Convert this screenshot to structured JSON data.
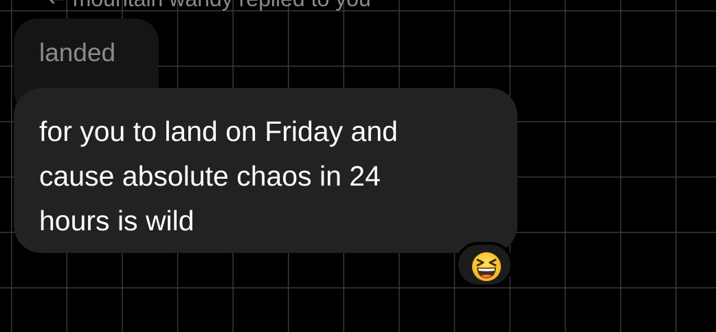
{
  "reply_header": "↩ mountain wandy replied to you",
  "quoted_message": {
    "text": "landed"
  },
  "message": {
    "text": "for you to land on Friday and\ncause absolute chaos in 24\nhours is wild"
  },
  "reaction": {
    "icon": "grinning-squinting-face-icon",
    "emoji": "😆"
  },
  "colors": {
    "background": "#000000",
    "grid_lines": "#3a3a3a",
    "bubble": "#222222",
    "quoted_bubble": "#151515",
    "text": "#ffffff",
    "muted_text": "#8a8a8a"
  }
}
